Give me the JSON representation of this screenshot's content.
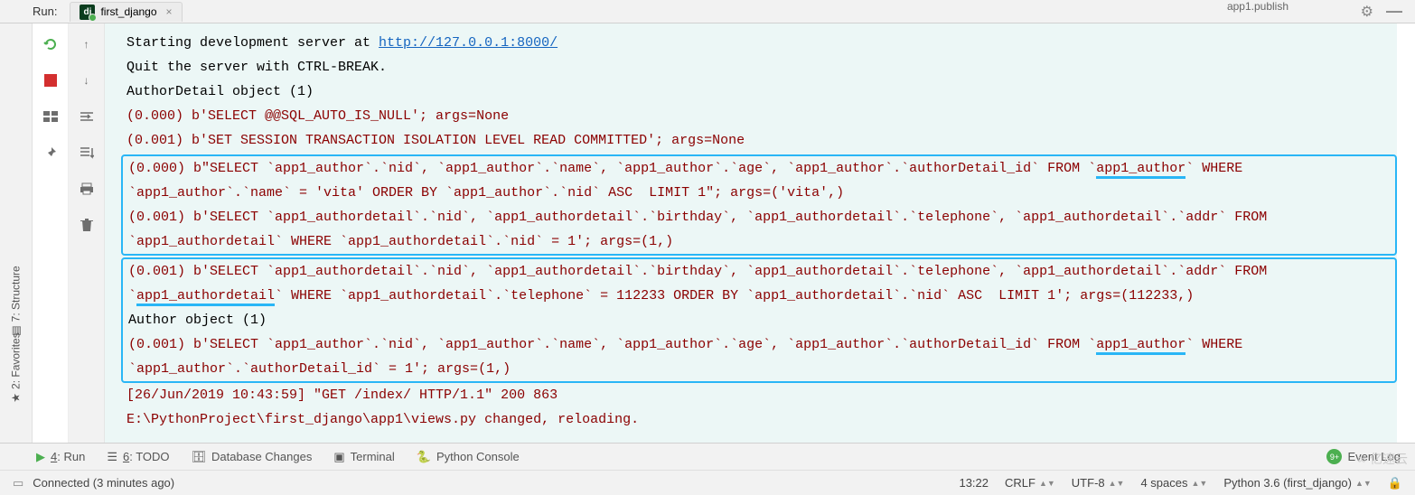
{
  "header": {
    "run_label": "Run:",
    "tab_name": "first_django",
    "top_stub": "app1.publish"
  },
  "sidebar": {
    "structure": "7: Structure",
    "favorites": "2: Favorites"
  },
  "console": {
    "l1a": "Starting development server at ",
    "l1b": "http://127.0.0.1:8000/",
    "l2": "Quit the server with CTRL-BREAK.",
    "l3": "AuthorDetail object (1)",
    "l4": "(0.000) b'SELECT @@SQL_AUTO_IS_NULL'; args=None",
    "l5": "(0.001) b'SET SESSION TRANSACTION ISOLATION LEVEL READ COMMITTED'; args=None",
    "l6a": "(0.000) b\"SELECT `app1_author`.`nid`, `app1_author`.`name`, `app1_author`.`age`, `app1_author`.`authorDetail_id` FROM `",
    "l6b": "app1_author",
    "l6c": "` WHERE ",
    "l7": "`app1_author`.`name` = 'vita' ORDER BY `app1_author`.`nid` ASC  LIMIT 1\"; args=('vita',)",
    "l8": "(0.001) b'SELECT `app1_authordetail`.`nid`, `app1_authordetail`.`birthday`, `app1_authordetail`.`telephone`, `app1_authordetail`.`addr` FROM ",
    "l9": "`app1_authordetail` WHERE `app1_authordetail`.`nid` = 1'; args=(1,)",
    "l10": "(0.001) b'SELECT `app1_authordetail`.`nid`, `app1_authordetail`.`birthday`, `app1_authordetail`.`telephone`, `app1_authordetail`.`addr` FROM ",
    "l11a": "`",
    "l11b": "app1_authordetail",
    "l11c": "` WHERE `app1_authordetail`.`telephone` = 112233 ORDER BY `app1_authordetail`.`nid` ASC  LIMIT 1'; args=(112233,)",
    "l12": "Author object (1)",
    "l13a": "(0.001) b'SELECT `app1_author`.`nid`, `app1_author`.`name`, `app1_author`.`age`, `app1_author`.`authorDetail_id` FROM `",
    "l13b": "app1_author",
    "l13c": "` WHERE ",
    "l14": "`app1_author`.`authorDetail_id` = 1'; args=(1,)",
    "l15": "[26/Jun/2019 10:43:59] \"GET /index/ HTTP/1.1\" 200 863",
    "l16": "E:\\PythonProject\\first_django\\app1\\views.py changed, reloading."
  },
  "bottom": {
    "run": "4: Run",
    "todo": "6: TODO",
    "db": "Database Changes",
    "terminal": "Terminal",
    "pyconsole": "Python Console",
    "event_log": "Event Log",
    "bubble": "9+"
  },
  "status": {
    "connected": "Connected (3 minutes ago)",
    "time": "13:22",
    "crlf": "CRLF",
    "enc": "UTF-8",
    "indent": "4 spaces",
    "py": "Python 3.6 (first_django)",
    "watermark": "亿速云"
  }
}
